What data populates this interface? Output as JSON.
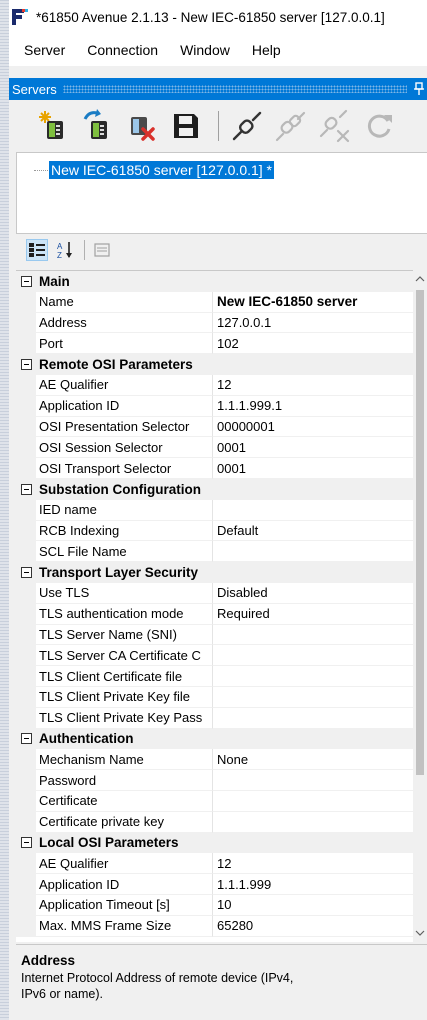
{
  "window": {
    "title": "*61850 Avenue 2.1.13 - New IEC-61850 server [127.0.0.1]"
  },
  "menu": [
    "Server",
    "Connection",
    "Window",
    "Help"
  ],
  "servers_panel": {
    "title": "Servers",
    "toolbar": [
      {
        "icon": "new-server-icon"
      },
      {
        "icon": "import-server-icon"
      },
      {
        "icon": "delete-server-icon"
      },
      {
        "icon": "save-icon"
      },
      {
        "icon": "connect-icon"
      },
      {
        "icon": "connect-all-icon"
      },
      {
        "icon": "disconnect-icon"
      },
      {
        "icon": "refresh-icon"
      }
    ],
    "tree": [
      {
        "label": "New IEC-61850 server [127.0.0.1] *"
      }
    ]
  },
  "property_grid": {
    "categories": [
      {
        "name": "Main",
        "rows": [
          {
            "name": "Name",
            "value": "New IEC-61850 server",
            "bold": true
          },
          {
            "name": "Address",
            "value": "127.0.0.1"
          },
          {
            "name": "Port",
            "value": "102"
          }
        ]
      },
      {
        "name": "Remote OSI Parameters",
        "rows": [
          {
            "name": "AE Qualifier",
            "value": "12"
          },
          {
            "name": "Application ID",
            "value": "1.1.1.999.1"
          },
          {
            "name": "OSI Presentation Selector",
            "value": "00000001"
          },
          {
            "name": "OSI Session Selector",
            "value": "0001"
          },
          {
            "name": "OSI Transport Selector",
            "value": "0001"
          }
        ]
      },
      {
        "name": "Substation Configuration",
        "rows": [
          {
            "name": "IED name",
            "value": ""
          },
          {
            "name": "RCB Indexing",
            "value": "Default"
          },
          {
            "name": "SCL File Name",
            "value": ""
          }
        ]
      },
      {
        "name": "Transport Layer Security",
        "rows": [
          {
            "name": "Use TLS",
            "value": "Disabled"
          },
          {
            "name": "TLS authentication mode",
            "value": "Required"
          },
          {
            "name": "TLS Server Name (SNI)",
            "value": ""
          },
          {
            "name": "TLS Server CA Certificate C",
            "value": ""
          },
          {
            "name": "TLS Client Certificate file",
            "value": ""
          },
          {
            "name": "TLS Client Private Key file",
            "value": ""
          },
          {
            "name": "TLS Client Private Key Pass",
            "value": ""
          }
        ]
      },
      {
        "name": "Authentication",
        "rows": [
          {
            "name": "Mechanism Name",
            "value": "None"
          },
          {
            "name": "Password",
            "value": ""
          },
          {
            "name": "Certificate",
            "value": ""
          },
          {
            "name": "Certificate private key",
            "value": ""
          }
        ]
      },
      {
        "name": "Local OSI Parameters",
        "rows": [
          {
            "name": "AE Qualifier",
            "value": "12"
          },
          {
            "name": "Application ID",
            "value": "1.1.1.999"
          },
          {
            "name": "Application Timeout [s]",
            "value": "10"
          },
          {
            "name": "Max. MMS Frame Size",
            "value": "65280"
          }
        ]
      }
    ]
  },
  "description": {
    "title": "Address",
    "text": "Internet Protocol Address of remote device (IPv4, IPv6 or name)."
  }
}
